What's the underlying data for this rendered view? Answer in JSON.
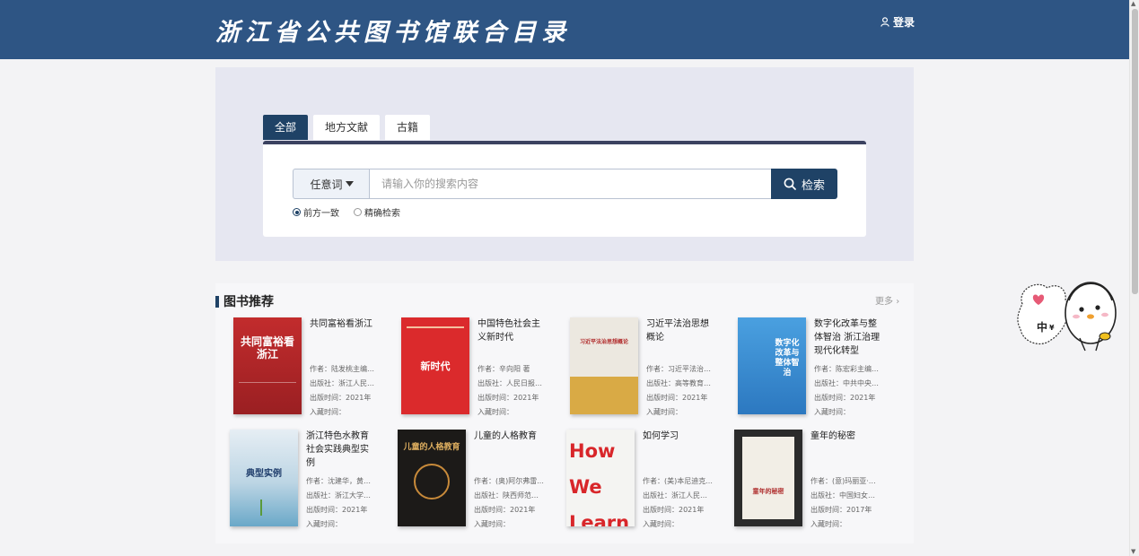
{
  "header": {
    "title": "浙江省公共图书馆联合目录",
    "login_label": "登录"
  },
  "search": {
    "tabs": [
      {
        "label": "全部",
        "active": true
      },
      {
        "label": "地方文献",
        "active": false
      },
      {
        "label": "古籍",
        "active": false
      }
    ],
    "field_select": "任意词",
    "placeholder": "请输入你的搜索内容",
    "button_label": "检索",
    "match_options": [
      {
        "label": "前方一致",
        "checked": true
      },
      {
        "label": "精确检索",
        "checked": false
      }
    ]
  },
  "recommend": {
    "heading": "图书推荐",
    "more_label": "更多",
    "author_prefix": "作者：",
    "publisher_prefix": "出版社：",
    "date_prefix": "出版时间：",
    "holding_prefix": "入藏时间：",
    "books": [
      {
        "title": "共同富裕看浙江",
        "author": "陆发桃主编；...",
        "publisher": "浙江人民出...",
        "date": "2021年",
        "holding": "",
        "cover_text": "共同富裕看浙江",
        "cover_color": "#b8262a"
      },
      {
        "title": "中国特色社会主义新时代",
        "author": "辛向阳 著",
        "publisher": "人民日报出...",
        "date": "2021年",
        "holding": "",
        "cover_text": "新时代",
        "cover_color": "#d8272b"
      },
      {
        "title": "习近平法治思想概论",
        "author": "习近平法治思...",
        "publisher": "高等教育出...",
        "date": "2021年",
        "holding": "",
        "cover_text": "习近平法治思想概论",
        "cover_color": "#e8e4dc"
      },
      {
        "title": "数字化改革与整体智治 浙江治理现代化转型",
        "author": "陈宏彩主编；...",
        "publisher": "中共中央党...",
        "date": "2021年",
        "holding": "",
        "cover_text": "数字化改革与整体智治",
        "cover_color": "#3a8fd4"
      },
      {
        "title": "浙江特色水教育社会实践典型实例",
        "author": "沈建华，黄正...",
        "publisher": "浙江大学出...",
        "date": "2021年",
        "holding": "",
        "cover_text": "典型实例",
        "cover_color": "#dfeaf2"
      },
      {
        "title": "儿童的人格教育",
        "author": "(奥)阿尔弗雷...",
        "publisher": "陕西师范大...",
        "date": "2021年",
        "holding": "",
        "cover_text": "儿童的人格教育",
        "cover_color": "#1c1a18"
      },
      {
        "title": "如何学习",
        "author": "(美)本尼迪克...",
        "publisher": "浙江人民出...",
        "date": "2021年",
        "holding": "",
        "cover_text": "How We Learn",
        "cover_color": "#f4f4f2"
      },
      {
        "title": "童年的秘密",
        "author": "(意)玛丽亚·蒙...",
        "publisher": "中国妇女出...",
        "date": "2017年",
        "holding": "",
        "cover_text": "童年的秘密",
        "cover_color": "#2b2b2b"
      }
    ]
  },
  "widget": {
    "lang_label": "中",
    "currency_label": "¥"
  },
  "colors": {
    "header": "#2e5584",
    "accent": "#1f4266",
    "search_bg": "#e6e7f1"
  }
}
